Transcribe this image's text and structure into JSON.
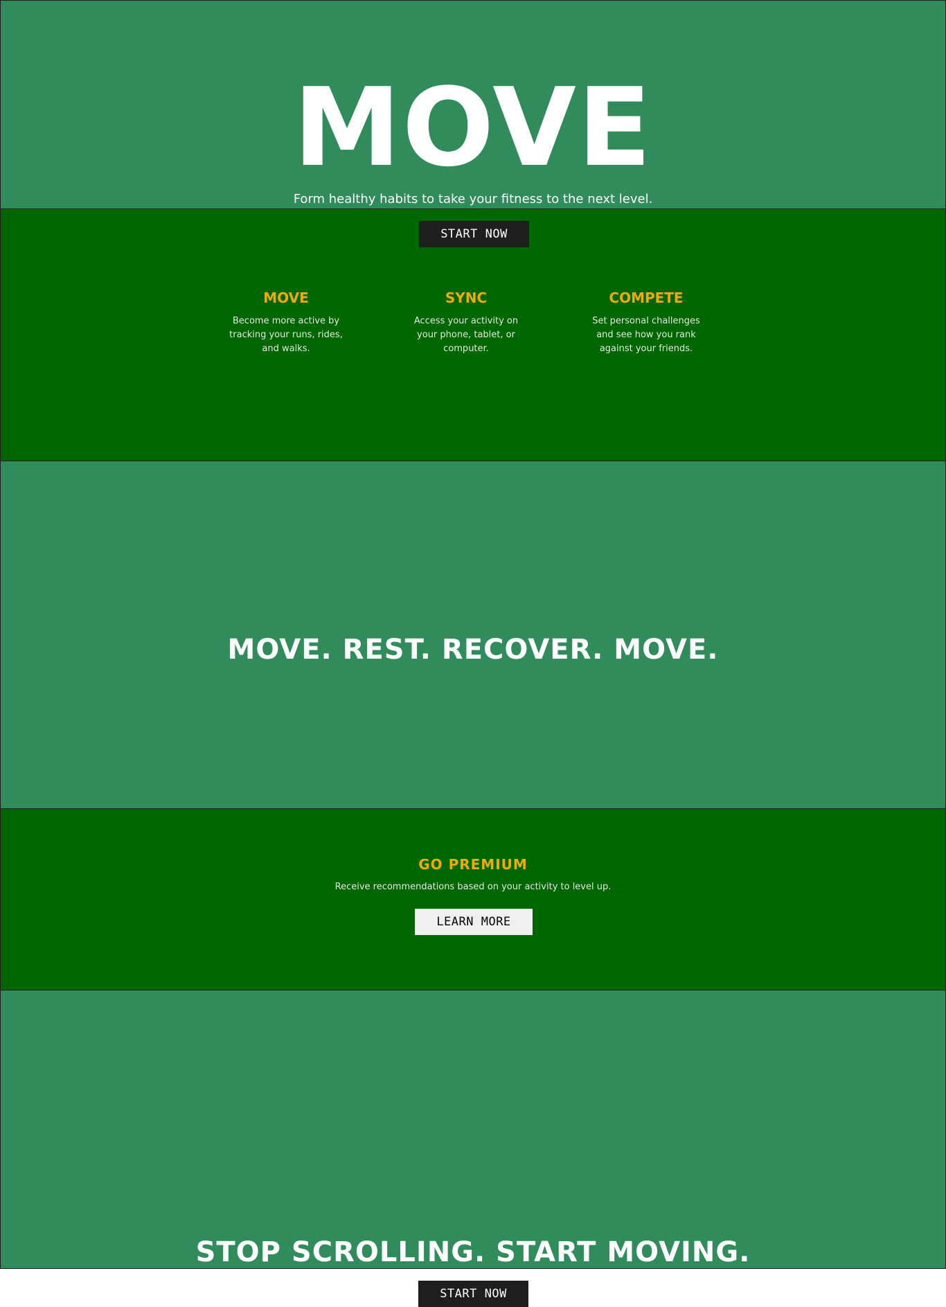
{
  "hero": {
    "title": "MOVE",
    "subtitle": "Form healthy habits to take your fitness to the next level."
  },
  "features": {
    "cta_label": "START NOW",
    "items": [
      {
        "title": "MOVE",
        "text": "Become more active by tracking your runs, rides, and walks."
      },
      {
        "title": "SYNC",
        "text": "Access your activity on your phone, tablet, or computer."
      },
      {
        "title": "COMPETE",
        "text": "Set personal challenges and see how you rank against your friends."
      }
    ]
  },
  "tagline": {
    "text": "MOVE. REST. RECOVER. MOVE."
  },
  "premium": {
    "title": "GO PREMIUM",
    "description": "Receive recommendations based on your activity to level up.",
    "cta_label": "LEARN MORE"
  },
  "closing": {
    "text": "STOP SCROLLING. START MOVING.",
    "cta_label": "START NOW"
  },
  "colors": {
    "light_green": "#308c5a",
    "dark_green": "#006600",
    "accent_gold": "#f2a900",
    "button_dark": "#1e1e1e",
    "button_light": "#efefef"
  }
}
